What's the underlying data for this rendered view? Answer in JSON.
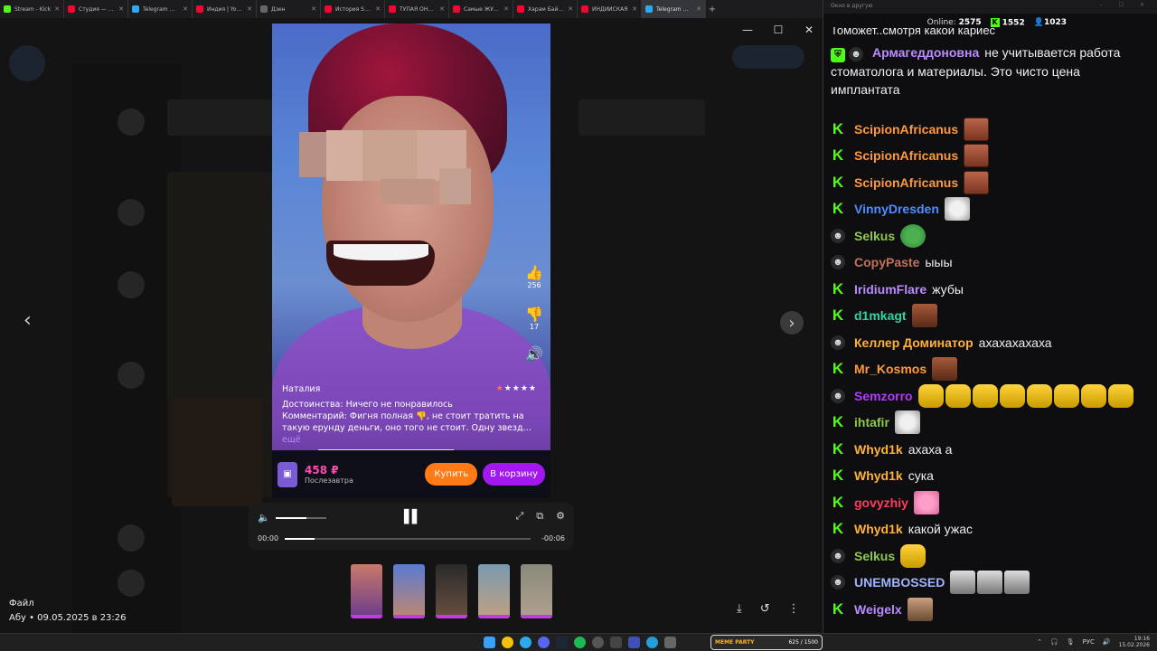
{
  "browser": {
    "tabs": [
      {
        "label": "Stream - Kick",
        "color": "#53fc18"
      },
      {
        "label": "Студия — YouTube",
        "color": "#ff0033"
      },
      {
        "label": "Telegram Web",
        "color": "#2aabee"
      },
      {
        "label": "Индия | YouTube",
        "color": "#ff0033"
      },
      {
        "label": "Дзен",
        "color": "#666666"
      },
      {
        "label": "История SAMSUNG",
        "color": "#ff0033"
      },
      {
        "label": "ТУПАЯ ОНЛАЙН",
        "color": "#ff0033"
      },
      {
        "label": "Самые ЖУТКИЕ",
        "color": "#ff0033"
      },
      {
        "label": "Харам Байрам",
        "color": "#ff0033"
      },
      {
        "label": "ИНДИЙСКАЯ",
        "color": "#ff0033"
      },
      {
        "label": "Telegram Web",
        "color": "#2aabee"
      }
    ],
    "new_tab": "+"
  },
  "viewer": {
    "review": {
      "name": "Наталия",
      "stars": "★★★★★",
      "pros": "Достоинства: Ничего не понравилось",
      "comment": "Комментарий: Фигня полная 👎, не стоит тратить на такую ерунду деньги, оно того не стоит. Одну звезд…",
      "more": "ещё"
    },
    "likes": "256",
    "dislikes": "17",
    "price": "458 ₽",
    "delivery": "Послезавтра",
    "buy_label": "Купить",
    "cart_label": "В корзину",
    "time_current": "00:00",
    "time_remaining": "-00:06",
    "playback_progress": 0.12,
    "volume_level": 0.6,
    "file_label": "Файл",
    "file_meta": "Абу • 09.05.2025 в 23:26"
  },
  "chat": {
    "top_label": "Окно в другую",
    "online_label": "Online:",
    "online": "2575",
    "count_a": "1552",
    "count_b": "1023",
    "partial_line": "Томожет..смотря какой кариес",
    "messages": [
      {
        "badges": [
          "shield",
          "sub"
        ],
        "user": "Армагеддоновна",
        "color": "#b98bff",
        "text": "не учитывается работа стоматолога и материалы. Это чисто цена имплантата",
        "emotes": []
      },
      {
        "badges": [
          "kick"
        ],
        "user": "ScipionAfricanus",
        "color": "#ff9a3c",
        "text": "",
        "emotes": [
          "pain"
        ]
      },
      {
        "badges": [
          "kick"
        ],
        "user": "ScipionAfricanus",
        "color": "#ff9a3c",
        "text": "",
        "emotes": [
          "pain"
        ]
      },
      {
        "badges": [
          "kick"
        ],
        "user": "ScipionAfricanus",
        "color": "#ff9a3c",
        "text": "",
        "emotes": [
          "pain"
        ]
      },
      {
        "badges": [
          "kick"
        ],
        "user": "VinnyDresden",
        "color": "#4f8cff",
        "text": "",
        "emotes": [
          "cat"
        ]
      },
      {
        "badges": [
          "sub"
        ],
        "user": "Selkus",
        "color": "#8ec94a",
        "text": "",
        "emotes": [
          "pepe"
        ]
      },
      {
        "badges": [
          "sub"
        ],
        "user": "CopyPaste",
        "color": "#c0725a",
        "text": "ыыы",
        "emotes": []
      },
      {
        "badges": [
          "kick"
        ],
        "user": "IridiumFlare",
        "color": "#b98bff",
        "text": "жубы",
        "emotes": []
      },
      {
        "badges": [
          "kick"
        ],
        "user": "d1mkagt",
        "color": "#2fd3a5",
        "text": "",
        "emotes": [
          "mon"
        ]
      },
      {
        "badges": [
          "sub"
        ],
        "user": "Келлер Доминатор",
        "color": "#ffb23a",
        "text": "ахахахахаха",
        "emotes": []
      },
      {
        "badges": [
          "kick"
        ],
        "user": "Mr_Kosmos",
        "color": "#ff9a3c",
        "text": "",
        "emotes": [
          "mon"
        ]
      },
      {
        "badges": [
          "sub"
        ],
        "user": "Semzorro",
        "color": "#b438ff",
        "text": "",
        "emotes": [
          "yel",
          "yel",
          "yel",
          "yel",
          "yel",
          "yel",
          "yel",
          "yel"
        ]
      },
      {
        "badges": [
          "kick"
        ],
        "user": "ihtafir",
        "color": "#8ec94a",
        "text": "",
        "emotes": [
          "cat"
        ]
      },
      {
        "badges": [
          "kick"
        ],
        "user": "Whyd1k",
        "color": "#ffb23a",
        "text": "ахаха а",
        "emotes": []
      },
      {
        "badges": [
          "kick"
        ],
        "user": "Whyd1k",
        "color": "#ffb23a",
        "text": "сука",
        "emotes": []
      },
      {
        "badges": [
          "kick"
        ],
        "user": "govyzhiy",
        "color": "#ff3d5a",
        "text": "",
        "emotes": [
          "pink"
        ]
      },
      {
        "badges": [
          "kick"
        ],
        "user": "Whyd1k",
        "color": "#ffb23a",
        "text": "какой ужас",
        "emotes": []
      },
      {
        "badges": [
          "sub"
        ],
        "user": "Selkus",
        "color": "#8ec94a",
        "text": "",
        "emotes": [
          "yel"
        ]
      },
      {
        "badges": [
          "sub"
        ],
        "user": "UNEMBOSSED",
        "color": "#9fb4ff",
        "text": "",
        "emotes": [
          "gray",
          "gray",
          "gray"
        ]
      },
      {
        "badges": [
          "kick"
        ],
        "user": "Weigelx",
        "color": "#b98bff",
        "text": "",
        "emotes": [
          "man"
        ]
      }
    ]
  },
  "taskbar": {
    "meme_label": "MEME PARTY",
    "meme_count": "625 / 1500",
    "lang": "РУС",
    "time": "19:16",
    "date": "15.02.2026"
  }
}
